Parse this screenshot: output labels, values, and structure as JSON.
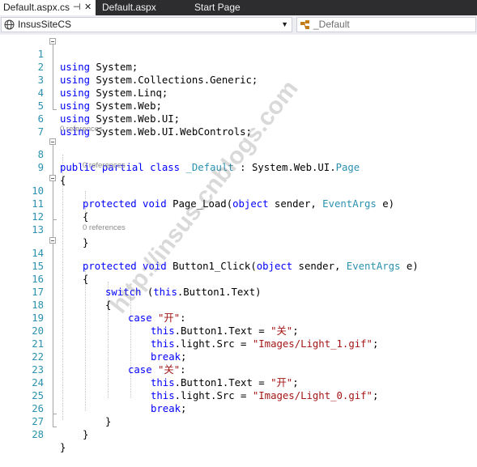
{
  "tabs": [
    {
      "label": "Default.aspx.cs",
      "active": true
    },
    {
      "label": "Default.aspx",
      "active": false
    },
    {
      "label": "Start Page",
      "active": false
    }
  ],
  "navbar": {
    "project_dropdown": "InsusSiteCS",
    "member_dropdown": "_Default"
  },
  "editor": {
    "code_lens": {
      "class_refs": "0 references",
      "page_load_refs": "0 references",
      "button1_click_refs": "0 references"
    },
    "lines": [
      {
        "n": "1"
      },
      {
        "n": "2"
      },
      {
        "n": "3"
      },
      {
        "n": "4"
      },
      {
        "n": "5"
      },
      {
        "n": "6"
      },
      {
        "n": "7"
      },
      {
        "n": "8"
      },
      {
        "n": "9"
      },
      {
        "n": "10"
      },
      {
        "n": "11"
      },
      {
        "n": "12"
      },
      {
        "n": "13"
      },
      {
        "n": "14"
      },
      {
        "n": "15"
      },
      {
        "n": "16"
      },
      {
        "n": "17"
      },
      {
        "n": "18"
      },
      {
        "n": "19"
      },
      {
        "n": "20"
      },
      {
        "n": "21"
      },
      {
        "n": "22"
      },
      {
        "n": "23"
      },
      {
        "n": "24"
      },
      {
        "n": "25"
      },
      {
        "n": "26"
      },
      {
        "n": "27"
      },
      {
        "n": "28"
      }
    ],
    "code": {
      "kw_using": "using",
      "l1": " System;",
      "l2": " System.Collections.Generic;",
      "l3": " System.Linq;",
      "l4": " System.Web;",
      "l5": " System.Web.UI;",
      "l6": " System.Web.UI.WebControls;",
      "kw_public": "public",
      "kw_partial": "partial",
      "kw_class": "class",
      "class_name": "_Default",
      "colon_sys": " : System.Web.UI.",
      "type_page": "Page",
      "brace_open": "{",
      "brace_close": "}",
      "kw_protected": "protected",
      "kw_void": "void",
      "page_load": " Page_Load(",
      "kw_object": "object",
      "sender": " sender, ",
      "type_eventargs": "EventArgs",
      "e_close": " e)",
      "button1_click": " Button1_Click(",
      "kw_switch": "switch",
      "switch_open": " (",
      "kw_this": "this",
      "switch_rest": ".Button1.Text)",
      "kw_case": "case",
      "str_kai": "\"开\"",
      "str_guan": "\"关\"",
      "colon": ":",
      "btn_text_assign": ".Button1.Text = ",
      "semicolon": ";",
      "light_src_assign": ".light.Src = ",
      "str_light1": "\"Images/Light_1.gif\"",
      "str_light0": "\"Images/Light_0.gif\"",
      "kw_break": "break",
      "space": " "
    }
  },
  "watermark": "http://insus.cnblogs.com"
}
